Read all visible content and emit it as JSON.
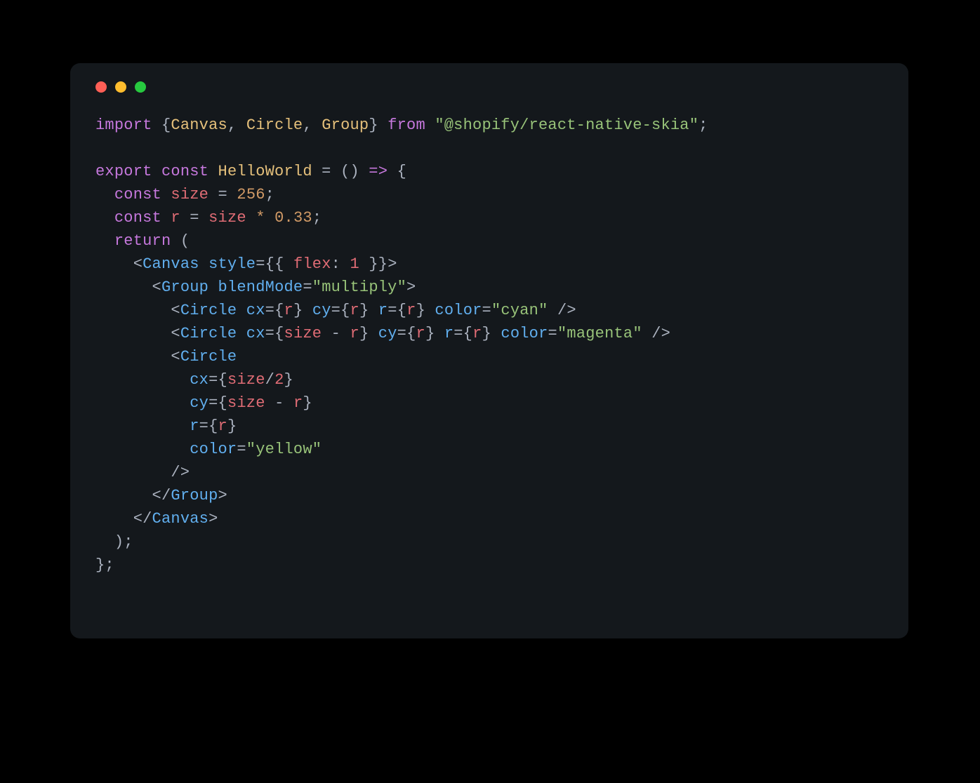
{
  "window": {
    "traffic": {
      "red": "#ff5f56",
      "yellow": "#ffbd2e",
      "green": "#27c93f"
    }
  },
  "code": {
    "tokens": [
      [
        {
          "t": "import ",
          "c": "tk-kw"
        },
        {
          "t": "{",
          "c": "tk-punc"
        },
        {
          "t": "Canvas",
          "c": "tk-def"
        },
        {
          "t": ", ",
          "c": "tk-punc"
        },
        {
          "t": "Circle",
          "c": "tk-def"
        },
        {
          "t": ", ",
          "c": "tk-punc"
        },
        {
          "t": "Group",
          "c": "tk-def"
        },
        {
          "t": "} ",
          "c": "tk-punc"
        },
        {
          "t": "from ",
          "c": "tk-kw"
        },
        {
          "t": "\"@shopify/react-native-skia\"",
          "c": "tk-str"
        },
        {
          "t": ";",
          "c": "tk-punc"
        }
      ],
      [],
      [
        {
          "t": "export ",
          "c": "tk-kw"
        },
        {
          "t": "const ",
          "c": "tk-kw"
        },
        {
          "t": "HelloWorld",
          "c": "tk-def"
        },
        {
          "t": " = () ",
          "c": "tk-punc"
        },
        {
          "t": "=>",
          "c": "tk-kw"
        },
        {
          "t": " {",
          "c": "tk-punc"
        }
      ],
      [
        {
          "t": "  ",
          "c": "tk-punc"
        },
        {
          "t": "const ",
          "c": "tk-kw"
        },
        {
          "t": "size",
          "c": "tk-var"
        },
        {
          "t": " = ",
          "c": "tk-punc"
        },
        {
          "t": "256",
          "c": "tk-num"
        },
        {
          "t": ";",
          "c": "tk-punc"
        }
      ],
      [
        {
          "t": "  ",
          "c": "tk-punc"
        },
        {
          "t": "const ",
          "c": "tk-kw"
        },
        {
          "t": "r",
          "c": "tk-var"
        },
        {
          "t": " = ",
          "c": "tk-punc"
        },
        {
          "t": "size",
          "c": "tk-var"
        },
        {
          "t": " * ",
          "c": "tk-op"
        },
        {
          "t": "0.33",
          "c": "tk-num"
        },
        {
          "t": ";",
          "c": "tk-punc"
        }
      ],
      [
        {
          "t": "  ",
          "c": "tk-punc"
        },
        {
          "t": "return",
          "c": "tk-kw"
        },
        {
          "t": " (",
          "c": "tk-punc"
        }
      ],
      [
        {
          "t": "    <",
          "c": "tk-punc"
        },
        {
          "t": "Canvas",
          "c": "tk-fn"
        },
        {
          "t": " ",
          "c": "tk-punc"
        },
        {
          "t": "style",
          "c": "tk-fn"
        },
        {
          "t": "={{ ",
          "c": "tk-punc"
        },
        {
          "t": "flex",
          "c": "tk-var"
        },
        {
          "t": ": ",
          "c": "tk-punc"
        },
        {
          "t": "1",
          "c": "tk-numred"
        },
        {
          "t": " }}>",
          "c": "tk-punc"
        }
      ],
      [
        {
          "t": "      <",
          "c": "tk-punc"
        },
        {
          "t": "Group",
          "c": "tk-fn"
        },
        {
          "t": " ",
          "c": "tk-punc"
        },
        {
          "t": "blendMode",
          "c": "tk-fn"
        },
        {
          "t": "=",
          "c": "tk-punc"
        },
        {
          "t": "\"multiply\"",
          "c": "tk-str"
        },
        {
          "t": ">",
          "c": "tk-punc"
        }
      ],
      [
        {
          "t": "        <",
          "c": "tk-punc"
        },
        {
          "t": "Circle",
          "c": "tk-fn"
        },
        {
          "t": " ",
          "c": "tk-punc"
        },
        {
          "t": "cx",
          "c": "tk-fn"
        },
        {
          "t": "={",
          "c": "tk-punc"
        },
        {
          "t": "r",
          "c": "tk-var"
        },
        {
          "t": "} ",
          "c": "tk-punc"
        },
        {
          "t": "cy",
          "c": "tk-fn"
        },
        {
          "t": "={",
          "c": "tk-punc"
        },
        {
          "t": "r",
          "c": "tk-var"
        },
        {
          "t": "} ",
          "c": "tk-punc"
        },
        {
          "t": "r",
          "c": "tk-fn"
        },
        {
          "t": "={",
          "c": "tk-punc"
        },
        {
          "t": "r",
          "c": "tk-var"
        },
        {
          "t": "} ",
          "c": "tk-punc"
        },
        {
          "t": "color",
          "c": "tk-fn"
        },
        {
          "t": "=",
          "c": "tk-punc"
        },
        {
          "t": "\"cyan\"",
          "c": "tk-str"
        },
        {
          "t": " />",
          "c": "tk-punc"
        }
      ],
      [
        {
          "t": "        <",
          "c": "tk-punc"
        },
        {
          "t": "Circle",
          "c": "tk-fn"
        },
        {
          "t": " ",
          "c": "tk-punc"
        },
        {
          "t": "cx",
          "c": "tk-fn"
        },
        {
          "t": "={",
          "c": "tk-punc"
        },
        {
          "t": "size",
          "c": "tk-var"
        },
        {
          "t": " - ",
          "c": "tk-punc"
        },
        {
          "t": "r",
          "c": "tk-var"
        },
        {
          "t": "} ",
          "c": "tk-punc"
        },
        {
          "t": "cy",
          "c": "tk-fn"
        },
        {
          "t": "={",
          "c": "tk-punc"
        },
        {
          "t": "r",
          "c": "tk-var"
        },
        {
          "t": "} ",
          "c": "tk-punc"
        },
        {
          "t": "r",
          "c": "tk-fn"
        },
        {
          "t": "={",
          "c": "tk-punc"
        },
        {
          "t": "r",
          "c": "tk-var"
        },
        {
          "t": "} ",
          "c": "tk-punc"
        },
        {
          "t": "color",
          "c": "tk-fn"
        },
        {
          "t": "=",
          "c": "tk-punc"
        },
        {
          "t": "\"magenta\"",
          "c": "tk-str"
        },
        {
          "t": " />",
          "c": "tk-punc"
        }
      ],
      [
        {
          "t": "        <",
          "c": "tk-punc"
        },
        {
          "t": "Circle",
          "c": "tk-fn"
        }
      ],
      [
        {
          "t": "          ",
          "c": "tk-punc"
        },
        {
          "t": "cx",
          "c": "tk-fn"
        },
        {
          "t": "={",
          "c": "tk-punc"
        },
        {
          "t": "size",
          "c": "tk-var"
        },
        {
          "t": "/",
          "c": "tk-punc"
        },
        {
          "t": "2",
          "c": "tk-numred"
        },
        {
          "t": "}",
          "c": "tk-punc"
        }
      ],
      [
        {
          "t": "          ",
          "c": "tk-punc"
        },
        {
          "t": "cy",
          "c": "tk-fn"
        },
        {
          "t": "={",
          "c": "tk-punc"
        },
        {
          "t": "size",
          "c": "tk-var"
        },
        {
          "t": " - ",
          "c": "tk-punc"
        },
        {
          "t": "r",
          "c": "tk-var"
        },
        {
          "t": "}",
          "c": "tk-punc"
        }
      ],
      [
        {
          "t": "          ",
          "c": "tk-punc"
        },
        {
          "t": "r",
          "c": "tk-fn"
        },
        {
          "t": "={",
          "c": "tk-punc"
        },
        {
          "t": "r",
          "c": "tk-var"
        },
        {
          "t": "}",
          "c": "tk-punc"
        }
      ],
      [
        {
          "t": "          ",
          "c": "tk-punc"
        },
        {
          "t": "color",
          "c": "tk-fn"
        },
        {
          "t": "=",
          "c": "tk-punc"
        },
        {
          "t": "\"yellow\"",
          "c": "tk-str"
        }
      ],
      [
        {
          "t": "        />",
          "c": "tk-punc"
        }
      ],
      [
        {
          "t": "      </",
          "c": "tk-punc"
        },
        {
          "t": "Group",
          "c": "tk-fn"
        },
        {
          "t": ">",
          "c": "tk-punc"
        }
      ],
      [
        {
          "t": "    </",
          "c": "tk-punc"
        },
        {
          "t": "Canvas",
          "c": "tk-fn"
        },
        {
          "t": ">",
          "c": "tk-punc"
        }
      ],
      [
        {
          "t": "  );",
          "c": "tk-punc"
        }
      ],
      [
        {
          "t": "};",
          "c": "tk-punc"
        }
      ]
    ]
  }
}
